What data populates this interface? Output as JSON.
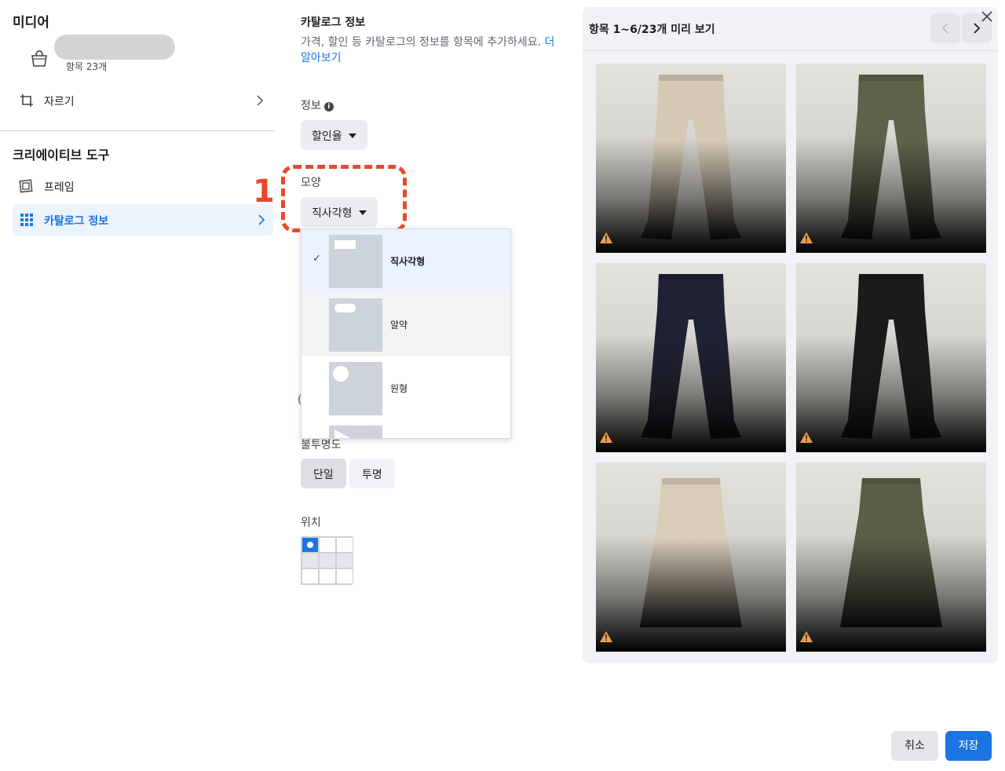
{
  "sidebar": {
    "media_heading": "미디어",
    "media_item_count": "항목 23개",
    "crop_label": "자르기",
    "creative_tools_heading": "크리에이티브 도구",
    "frame_label": "프레임",
    "catalog_info_label": "카탈로그 정보"
  },
  "settings": {
    "title": "카탈로그 정보",
    "description": "가격, 할인 등 카탈로그의 정보를 항목에 추가하세요.",
    "learn_more": "더 알아보기",
    "info_label": "정보",
    "info_value": "할인율",
    "shape_label": "모양",
    "shape_value": "직사각형",
    "annotation_number": "1",
    "opacity_label": "불투명도",
    "opacity_options": [
      "단일",
      "투명"
    ],
    "opacity_selected": "단일",
    "position_label": "위치"
  },
  "shape_menu": {
    "items": [
      {
        "label": "직사각형",
        "selected": true
      },
      {
        "label": "알약",
        "selected": false
      },
      {
        "label": "원형",
        "selected": false
      }
    ]
  },
  "preview": {
    "title": "항목 1~6/23개 미리 보기",
    "products": [
      {
        "name": "beige-pants",
        "color": "#d5c9b4"
      },
      {
        "name": "olive-pants",
        "color": "#5d6249"
      },
      {
        "name": "navy-pants",
        "color": "#1f2236"
      },
      {
        "name": "black-pants",
        "color": "#1b1b1c"
      },
      {
        "name": "beige-skirt",
        "color": "#d9cdb8"
      },
      {
        "name": "olive-skirt",
        "color": "#5a5f46"
      }
    ]
  },
  "footer": {
    "cancel_label": "취소",
    "save_label": "저장"
  },
  "colors": {
    "accent": "#1b74e4",
    "annotation": "#e8492a",
    "warning": "#f0a04b"
  }
}
